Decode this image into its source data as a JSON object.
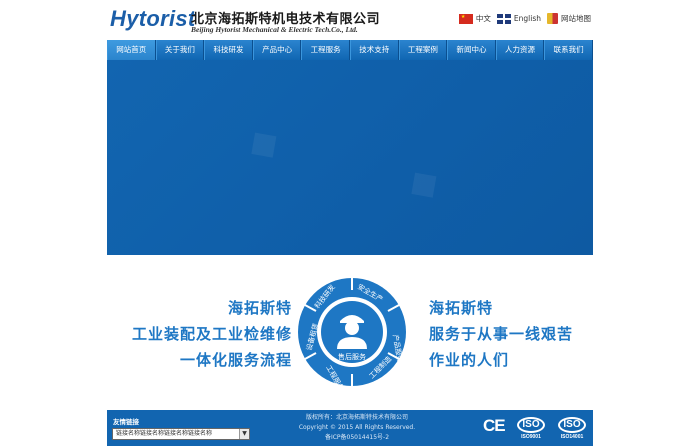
{
  "header": {
    "logo_word": "Hytorist",
    "logo_cn": "北京海拓斯特机电技术有限公司",
    "logo_en": "Beijing Hytorist Mechanical & Electric Tech.Co., Ltd.",
    "links": [
      {
        "icon": "china-flag-icon",
        "label": "中文"
      },
      {
        "icon": "uk-flag-icon",
        "label": "English"
      },
      {
        "icon": "sitemap-icon",
        "label": "网站地图"
      }
    ]
  },
  "nav": {
    "items": [
      "网站首页",
      "关于我们",
      "科技研发",
      "产品中心",
      "工程服务",
      "技术支持",
      "工程案例",
      "新闻中心",
      "人力资源",
      "联系我们"
    ]
  },
  "hero": {
    "left_slogans": [
      "海拓斯特",
      "工业装配及工业检维修",
      "一体化服务流程"
    ],
    "right_slogans": [
      "海拓斯特",
      "服务于从事一线艰苦",
      "作业的人们"
    ],
    "ring_labels": [
      "科技研发",
      "安全生产",
      "产品服务",
      "工程服务",
      "设备租赁",
      "工程制造"
    ],
    "center_label": "售后服务",
    "center_icon": "worker-icon",
    "accent": "#1e77c4"
  },
  "footer": {
    "links_title": "友情链接",
    "links_select": "链接名称链接名称链接名称链接名称",
    "copyright_lines": [
      "版权所有：北京海拓斯特技术有限公司",
      "Copyright © 2015  All Rights Reserved.",
      "备ICP备05014415号-2"
    ],
    "certs": [
      {
        "icon": "ce-mark-icon",
        "label": "CE"
      },
      {
        "icon": "iso9001-icon",
        "label": "ISO",
        "sub": "ISO9001"
      },
      {
        "icon": "iso14001-icon",
        "label": "ISO",
        "sub": "ISO14001"
      }
    ],
    "bg": "#1265b0"
  }
}
